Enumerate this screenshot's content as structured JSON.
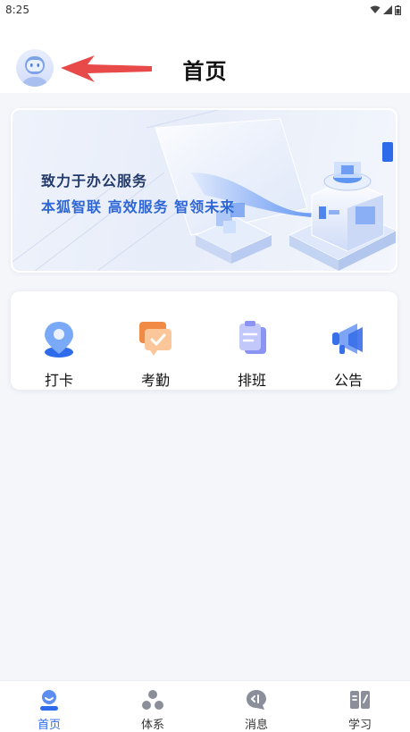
{
  "status_bar": {
    "time": "8:25",
    "icons": [
      "wifi-icon",
      "signal-icon",
      "battery-icon"
    ]
  },
  "header": {
    "title": "首页",
    "avatar_icon": "robot-avatar-icon",
    "annotation_arrow_color": "#e84a4a"
  },
  "banner": {
    "title": "致力于办公服务",
    "subtitle": "本狐智联 高效服务 智领未来"
  },
  "quick_actions": [
    {
      "label": "打卡",
      "icon": "location-pin-icon"
    },
    {
      "label": "考勤",
      "icon": "attendance-message-icon"
    },
    {
      "label": "排班",
      "icon": "schedule-clipboard-icon"
    },
    {
      "label": "公告",
      "icon": "megaphone-icon"
    }
  ],
  "tabbar": {
    "items": [
      {
        "label": "首页",
        "icon": "home-person-icon",
        "active": true
      },
      {
        "label": "体系",
        "icon": "system-nodes-icon",
        "active": false
      },
      {
        "label": "消息",
        "icon": "message-bubble-icon",
        "active": false
      },
      {
        "label": "学习",
        "icon": "open-book-icon",
        "active": false
      }
    ]
  },
  "colors": {
    "accent": "#2e6bea",
    "banner_subtitle": "#2e66d6",
    "banner_title": "#233a6a",
    "background": "#f4f6fa"
  }
}
